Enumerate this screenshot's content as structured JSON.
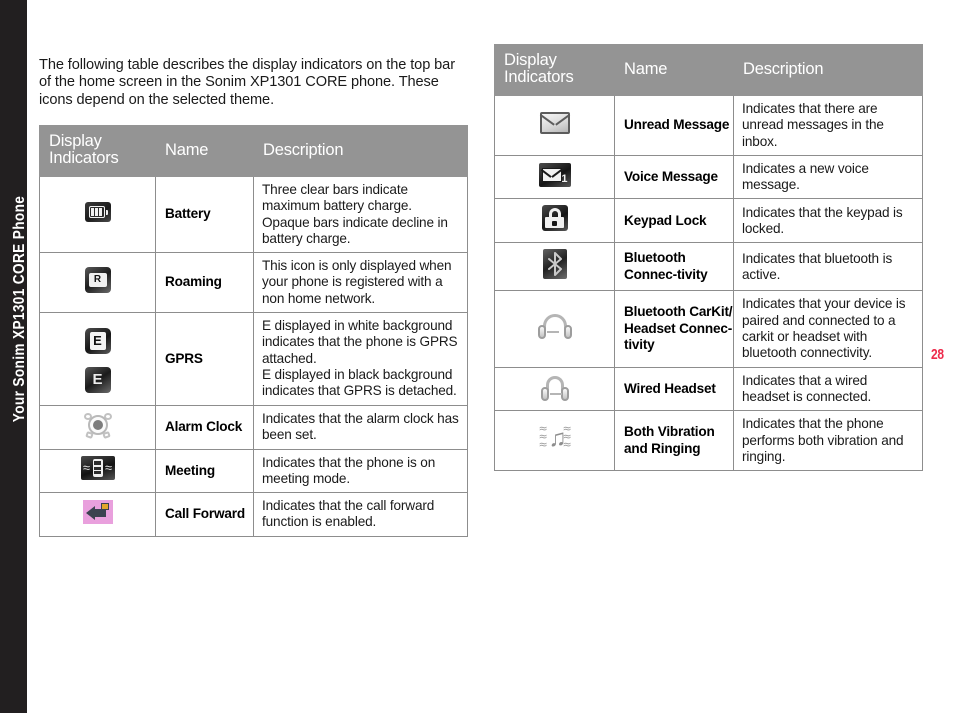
{
  "spine": {
    "label": "Your Sonim XP1301 CORE Phone"
  },
  "page_number": "28",
  "intro": {
    "text": "The following table describes the display indicators on the top bar of the home screen in the Sonim XP1301 CORE phone. These icons depend on the selected theme."
  },
  "colors": {
    "header_gray": "#949494",
    "spine_black": "#221f20",
    "page_number_red": "#ed2b4c",
    "border_gray": "#8d8d8d",
    "call_forward_pink": "#e9a0dd"
  },
  "table_left": {
    "headers": {
      "col1": "Display Indicators",
      "col2": "Name",
      "col3": "Description"
    },
    "rows": [
      {
        "icon": "battery-icon",
        "name": "Battery",
        "description": "Three clear bars indicate maximum battery charge. Opaque bars indicate decline in battery charge."
      },
      {
        "icon": "roaming-icon",
        "name": "Roaming",
        "description": "This icon is only displayed when your phone is registered with a non home network."
      },
      {
        "icon": "gprs-icon",
        "name": "GPRS",
        "description": "E displayed in white background indicates that the phone is GPRS attached.\nE displayed in black background indicates that GPRS is detached."
      },
      {
        "icon": "alarm-clock-icon",
        "name": "Alarm Clock",
        "description": "Indicates that the alarm clock has been set."
      },
      {
        "icon": "meeting-icon",
        "name": "Meeting",
        "description": "Indicates that the phone is on meeting mode."
      },
      {
        "icon": "call-forward-icon",
        "name": "Call Forward",
        "description": "Indicates that the call forward function is enabled."
      }
    ]
  },
  "table_right": {
    "headers": {
      "col1": "Display Indicators",
      "col2": "Name",
      "col3": "Description"
    },
    "rows": [
      {
        "icon": "unread-message-icon",
        "name": "Unread Message",
        "description": "Indicates that there are unread messages in the inbox."
      },
      {
        "icon": "voice-message-icon",
        "icon_badge": "1",
        "name": "Voice Message",
        "description": "Indicates a new voice message."
      },
      {
        "icon": "keypad-lock-icon",
        "name": "Keypad Lock",
        "description": "Indicates that the keypad is locked."
      },
      {
        "icon": "bluetooth-icon",
        "name": "Bluetooth Connec-tivity",
        "description": "Indicates that bluetooth is active."
      },
      {
        "icon": "bluetooth-headset-icon",
        "name": "Bluetooth CarKit/ Headset Connec-tivity",
        "description": "Indicates that your device is paired and connected to a carkit or headset with bluetooth connectivity."
      },
      {
        "icon": "wired-headset-icon",
        "name": "Wired Headset",
        "description": "Indicates that a wired headset is connected."
      },
      {
        "icon": "vibration-ringing-icon",
        "name": "Both Vibration and Ringing",
        "description": "Indicates that the phone performs both vibration and ringing."
      }
    ]
  },
  "icon_glyphs": {
    "roaming_letter": "R",
    "gprs_white_letter": "E",
    "gprs_black_letter": "E",
    "meeting_wave_left": "≈",
    "meeting_wave_right": "≈",
    "vib_note": "♫",
    "vib_wave": "≈"
  }
}
